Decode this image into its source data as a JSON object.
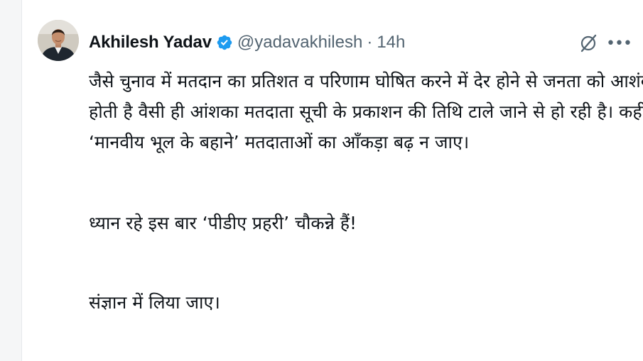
{
  "tweet": {
    "author_name": "Akhilesh Yadav",
    "handle": "@yadavakhilesh",
    "separator": "·",
    "timestamp": "14h",
    "lines": [
      "जैसे चुनाव में मतदान का प्रतिशत व परिणाम घोषित करने में देर होने से जनता को आशंका",
      "होती है वैसी ही आंशका मतदाता सूची के प्रकाशन की तिथि टाले जाने से हो रही है। कहीं",
      "‘मानवीय भूल के बहाने’ मतदाताओं का आँकड़ा बढ़ न जाए।",
      "ध्यान रहे इस बार ‘पीडीए प्रहरी’ चौकन्ने हैं!",
      "संज्ञान में लिया जाए।"
    ],
    "more_label": "•••"
  },
  "icons": {
    "avatar": "profile-photo",
    "verified": "verified-badge-icon",
    "grok": "grok-icon",
    "more": "more-icon"
  },
  "colors": {
    "verified_blue": "#1d9bf0",
    "text_primary": "#0f1419",
    "text_secondary": "#536471"
  }
}
